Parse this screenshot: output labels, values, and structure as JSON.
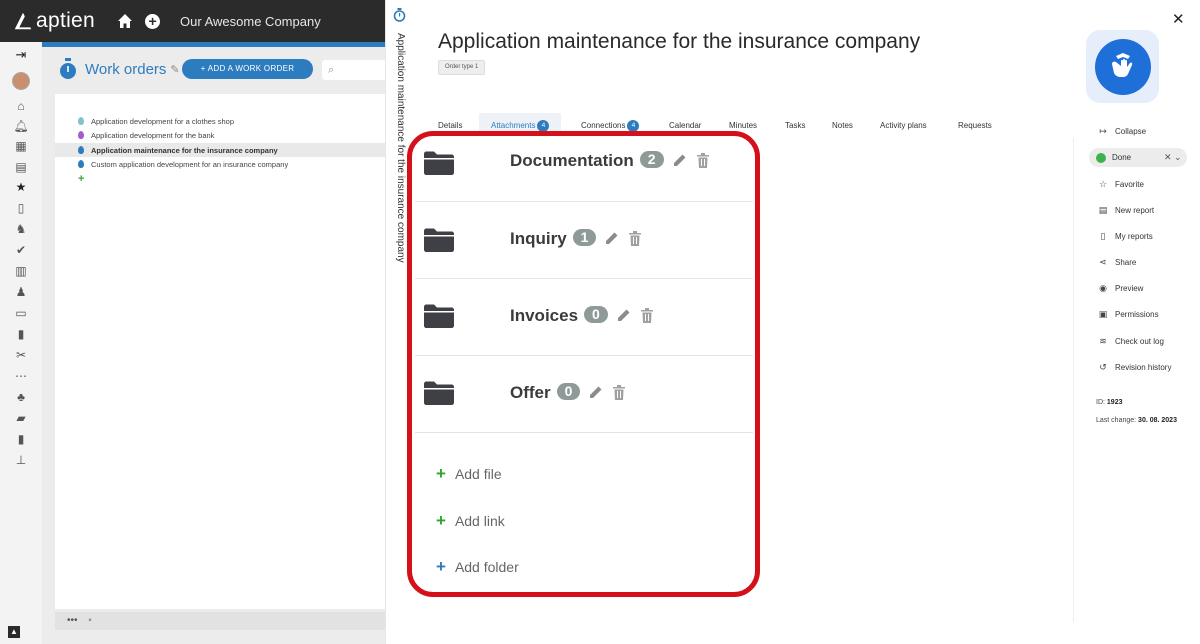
{
  "app": {
    "logo_text": "aptien",
    "company": "Our Awesome Company"
  },
  "workorders": {
    "title": "Work orders",
    "add_button": "+ ADD A WORK ORDER",
    "search_placeholder": "",
    "items": [
      {
        "label": "Application development for a clothes shop",
        "color": "#7fc3cf",
        "selected": false
      },
      {
        "label": "Application development for the bank",
        "color": "#a25bd1",
        "selected": false
      },
      {
        "label": "Application maintenance for the insurance company",
        "color": "#2d7cbf",
        "selected": true
      },
      {
        "label": "Custom application development for an insurance company",
        "color": "#2d7cbf",
        "selected": false
      }
    ],
    "bottom_more": "•••"
  },
  "detail": {
    "vertical_title": "Application maintenance for the insurance company",
    "title": "Application maintenance for the insurance company",
    "order_type": "Order type 1",
    "tabs": [
      {
        "label": "Details",
        "count": null,
        "active": false
      },
      {
        "label": "Attachments",
        "count": "4",
        "active": true
      },
      {
        "label": "Connections",
        "count": "4",
        "active": false
      },
      {
        "label": "Calendar",
        "count": null,
        "active": false
      },
      {
        "label": "Minutes",
        "count": null,
        "active": false
      },
      {
        "label": "Tasks",
        "count": null,
        "active": false
      },
      {
        "label": "Notes",
        "count": null,
        "active": false
      },
      {
        "label": "Activity plans",
        "count": null,
        "active": false
      },
      {
        "label": "Requests",
        "count": null,
        "active": false
      }
    ],
    "folders": [
      {
        "name": "Documentation",
        "count": "2"
      },
      {
        "name": "Inquiry",
        "count": "1"
      },
      {
        "name": "Invoices",
        "count": "0"
      },
      {
        "name": "Offer",
        "count": "0"
      }
    ],
    "actions": [
      {
        "label": "Add file",
        "color": "#2ea52e"
      },
      {
        "label": "Add link",
        "color": "#2ea52e"
      },
      {
        "label": "Add folder",
        "color": "#2d7cbf"
      }
    ],
    "highlight_color": "#d5101b"
  },
  "sidebar": {
    "collapse": "Collapse",
    "status": "Done",
    "items": [
      "Favorite",
      "New report",
      "My reports",
      "Share",
      "Preview",
      "Permissions",
      "Check out log",
      "Revision history"
    ],
    "id_label": "ID:",
    "id_value": "1923",
    "last_change_label": "Last change:",
    "last_change_value": "30. 08. 2023"
  }
}
